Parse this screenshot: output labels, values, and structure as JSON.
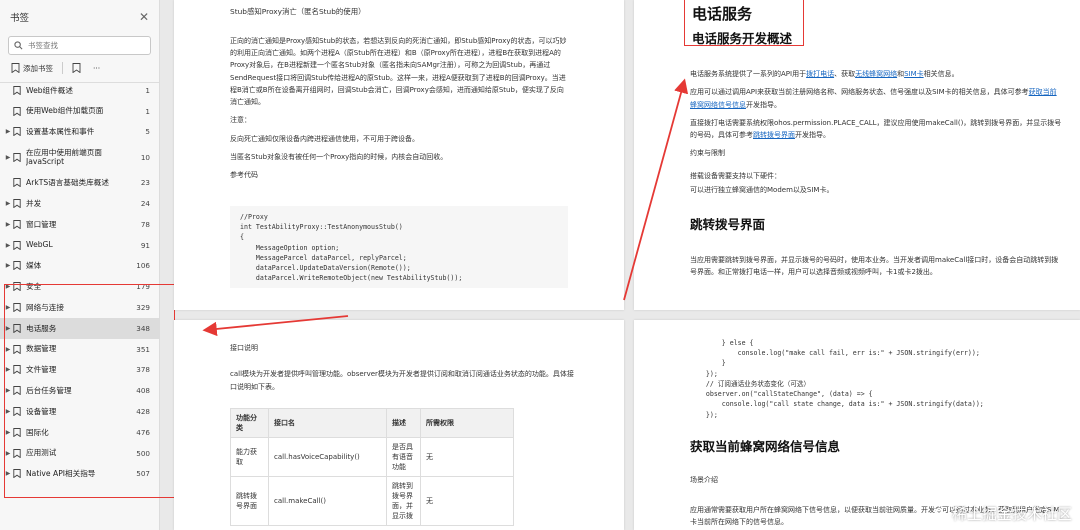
{
  "sidebar": {
    "title": "书签",
    "search_placeholder": "书签查找",
    "add_bookmark": "添加书签",
    "more": "···",
    "items": [
      {
        "label": "Web组件概述",
        "page": "1",
        "expand": false
      },
      {
        "label": "使用Web组件加载页面",
        "page": "1",
        "expand": false
      },
      {
        "label": "设置基本属性和事件",
        "page": "5",
        "expand": true
      },
      {
        "label": "在应用中使用前端页面JavaScript",
        "page": "10",
        "expand": true
      },
      {
        "label": "ArkTS语言基础类库概述",
        "page": "23",
        "expand": false
      },
      {
        "label": "并发",
        "page": "24",
        "expand": true
      },
      {
        "label": "窗口管理",
        "page": "78",
        "expand": true
      },
      {
        "label": "WebGL",
        "page": "91",
        "expand": true
      },
      {
        "label": "媒体",
        "page": "106",
        "expand": true
      },
      {
        "label": "安全",
        "page": "179",
        "expand": true
      },
      {
        "label": "网络与连接",
        "page": "329",
        "expand": true
      },
      {
        "label": "电话服务",
        "page": "348",
        "expand": true
      },
      {
        "label": "数据管理",
        "page": "351",
        "expand": true
      },
      {
        "label": "文件管理",
        "page": "378",
        "expand": true
      },
      {
        "label": "后台任务管理",
        "page": "408",
        "expand": true
      },
      {
        "label": "设备管理",
        "page": "428",
        "expand": true
      },
      {
        "label": "国际化",
        "page": "476",
        "expand": true
      },
      {
        "label": "应用测试",
        "page": "500",
        "expand": true
      },
      {
        "label": "Native API相关指导",
        "page": "507",
        "expand": true
      }
    ]
  },
  "page_tl": {
    "heading": "Stub感知Proxy消亡（匿名Stub的使用）",
    "para1": "正向的消亡通知是Proxy感知Stub的状态，若想达到反向的死消亡通知，即Stub感知Proxy的状态，可以巧妙的利用正向消亡通知。如两个进程A（原Stub所在进程）和B（原Proxy所在进程），进程B在获取到进程A的Proxy对象后，在B进程新建一个匿名Stub对象（匿名指未向SAMgr注册），可称之为回调Stub，再通过SendRequest接口将回调Stub传给进程A的原Stub。这样一来，进程A便获取到了进程B的回调Proxy。当进程B消亡或B所在设备离开组网时，回调Stub会消亡，回调Proxy会感知，进而通知给原Stub，便实现了反向消亡通知。",
    "note_label": "注意：",
    "note1": "反向死亡通知仅限设备内跨进程通信使用，不可用于跨设备。",
    "note2": "当匿名Stub对象没有被任何一个Proxy指向的时候，内核会自动回收。",
    "ref": "参考代码",
    "code": "//Proxy\nint TestAbilityProxy::TestAnonymousStub()\n{\n    MessageOption option;\n    MessageParcel dataParcel, replyParcel;\n    dataParcel.UpdateDataVersion(Remote());\n    dataParcel.WriteRemoteObject(new TestAbilityStub());"
  },
  "page_tr": {
    "h1": "电话服务",
    "h2": "电话服务开发概述",
    "p1_a": "电话服务系统提供了一系列的API用于",
    "p1_link1": "拨打电话",
    "p1_b": "、获取",
    "p1_link2": "无线蜂窝网络",
    "p1_c": "和",
    "p1_link3": "SIM卡",
    "p1_d": "相关信息。",
    "p2_a": "应用可以通过调用API来获取当前注册网络名称、网络服务状态、信号强度以及SIM卡的相关信息，具体可参考",
    "p2_link": "获取当前蜂窝网络信号信息",
    "p2_b": "开发指导。",
    "p3_a": "直接拨打电话需要系统权限ohos.permission.PLACE_CALL，建议应用使用makeCall()，跳转到拨号界面，并显示拨号的号码，具体可参考",
    "p3_link": "跳转拨号界面",
    "p3_b": "开发指导。",
    "constraints": "约束与限制",
    "c1": "搭载设备需要支持以下硬件：",
    "c2": "可以进行独立蜂窝通信的Modem以及SIM卡。",
    "h3": "跳转拨号界面",
    "p4": "当应用需要跳转到拨号界面，并显示拨号的号码时，使用本业务。当开发者调用makeCall接口时，设备会自动跳转到拨号界面。和正常拨打电话一样，用户可以选择音频或视频呼叫，卡1或卡2拨出。"
  },
  "page_bl": {
    "heading": "接口说明",
    "para": "call模块为开发者提供呼叫管理功能。observer模块为开发者提供订阅和取消订阅通话业务状态的功能。具体接口说明如下表。",
    "table": {
      "headers": [
        "功能分类",
        "接口名",
        "描述",
        "所需权限"
      ],
      "rows": [
        [
          "能力获取",
          "call.hasVoiceCapability()",
          "是否具有语音功能",
          "无"
        ],
        [
          "跳转拨号界面",
          "call.makeCall()",
          "跳转到拨号界面，并显示拨",
          "无"
        ]
      ]
    }
  },
  "page_br": {
    "code": "        } else {\n            console.log(\"make call fail, err is:\" + JSON.stringify(err));\n        }\n    });\n    // 订阅通话业务状态变化（可选）\n    observer.on(\"callStateChange\", (data) => {\n        console.log(\"call state change, data is:\" + JSON.stringify(data));\n    });",
    "h3": "获取当前蜂窝网络信号信息",
    "scene": "场景介绍",
    "p1": "应用通常需要获取用户所在蜂窝网络下信号信息，以便获取当前驻网质量。开发者可以通过本业务，获取到用户指定SIM卡当前所在网络下的信号信息。"
  },
  "watermark": "稀土掘金技术社区"
}
